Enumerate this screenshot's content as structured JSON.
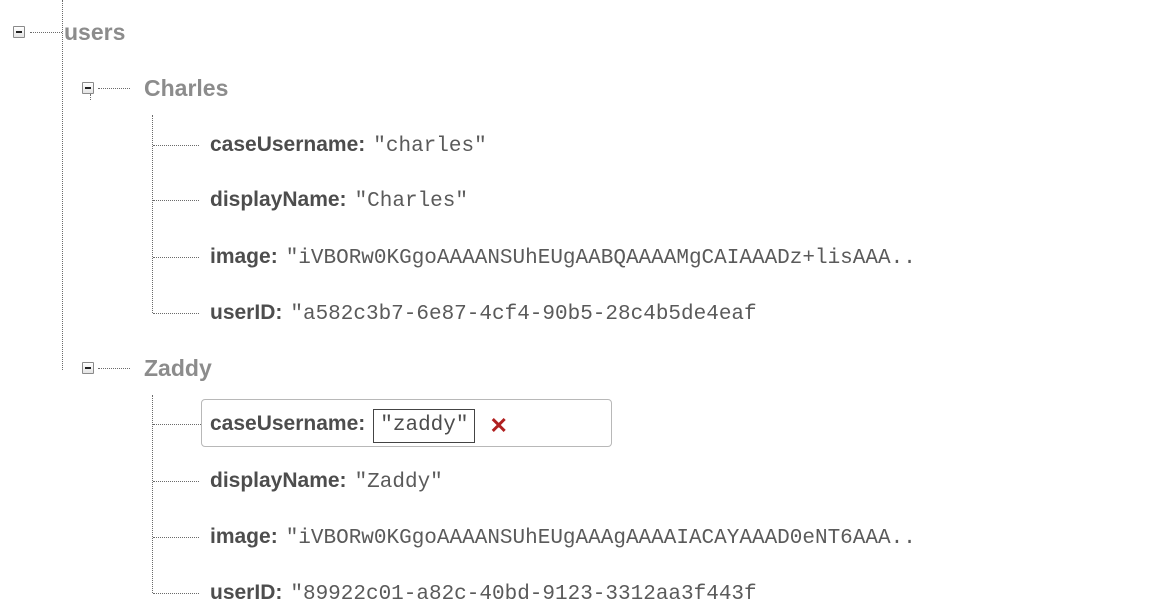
{
  "root": {
    "label": "users"
  },
  "users": [
    {
      "label": "Charles",
      "fields": [
        {
          "key": "caseUsername:",
          "value": "\"charles\""
        },
        {
          "key": "displayName:",
          "value": "\"Charles\""
        },
        {
          "key": "image:",
          "value": "\"iVBORw0KGgoAAAANSUhEUgAABQAAAAMgCAIAAADz+lisAAA.."
        },
        {
          "key": "userID:",
          "value": "\"a582c3b7-6e87-4cf4-90b5-28c4b5de4eaf"
        }
      ]
    },
    {
      "label": "Zaddy",
      "fields": [
        {
          "key": "caseUsername:",
          "value": "\"zaddy\""
        },
        {
          "key": "displayName:",
          "value": "\"Zaddy\""
        },
        {
          "key": "image:",
          "value": "\"iVBORw0KGgoAAAANSUhEUgAAAgAAAAIACAYAAAD0eNT6AAA.."
        },
        {
          "key": "userID:",
          "value": "\"89922c01-a82c-40bd-9123-3312aa3f443f"
        }
      ]
    }
  ],
  "editor": {
    "remove_symbol": "✕",
    "remove_icon": "close-icon",
    "remove_color": "#b02020"
  }
}
